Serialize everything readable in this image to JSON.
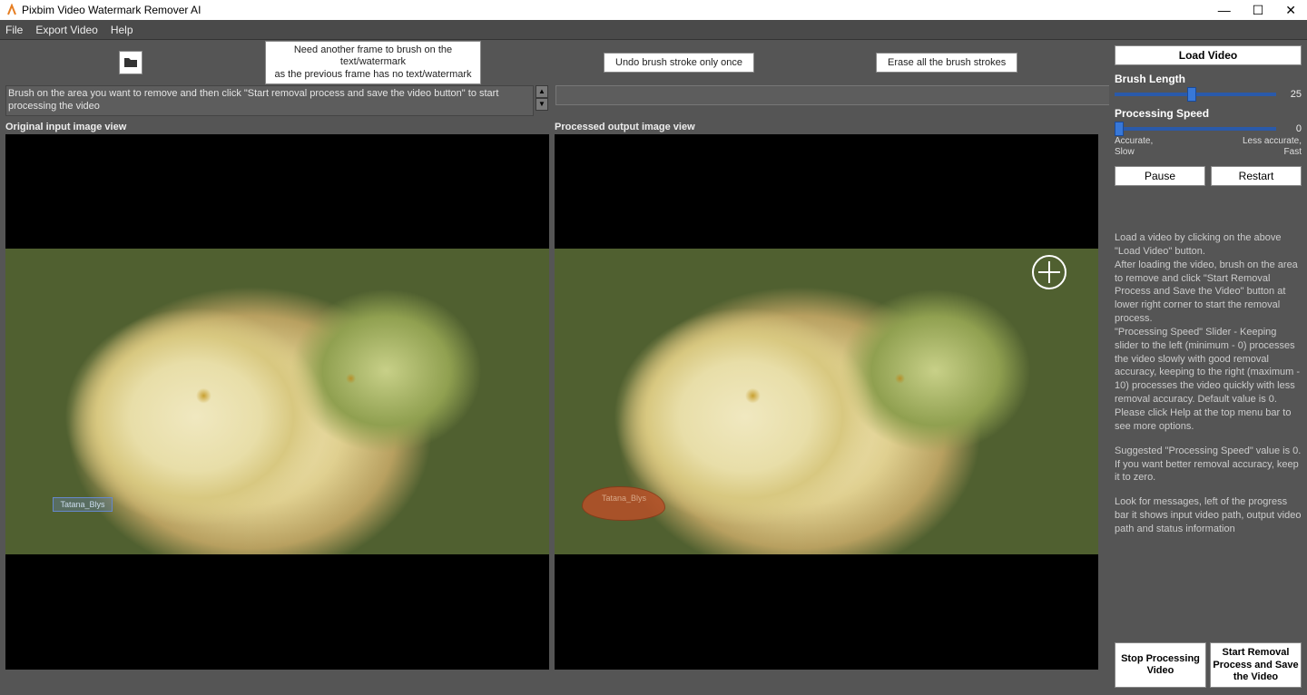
{
  "title_bar": {
    "app_title": "Pixbim Video Watermark Remover AI"
  },
  "menu": {
    "file": "File",
    "export": "Export Video",
    "help": "Help"
  },
  "toolbar": {
    "hint_line1": "Need another frame to brush on the text/watermark",
    "hint_line2": "as the previous frame has no text/watermark",
    "undo": "Undo brush stroke only once",
    "erase": "Erase all the brush strokes"
  },
  "status_text": "Brush on the area you want to remove and then click \"Start removal process and save the video button\" to start processing the video",
  "view_labels": {
    "left": "Original input image view",
    "right": "Processed output image view"
  },
  "watermark_text": "Tatana_Blys",
  "right_panel": {
    "load_video": "Load Video",
    "brush_length_label": "Brush Length",
    "brush_length_value": "25",
    "processing_speed_label": "Processing Speed",
    "processing_speed_value": "0",
    "speed_left_1": "Accurate,",
    "speed_left_2": "Slow",
    "speed_right_1": "Less accurate,",
    "speed_right_2": "Fast",
    "pause": "Pause",
    "restart": "Restart",
    "help_p1": "Load a video by clicking on the above \"Load Video\" button.",
    "help_p2": "After loading the video, brush on the area to remove and click \"Start Removal Process and Save the Video\" button at lower right corner to start the removal process.",
    "help_p3": "\"Processing Speed\" Slider - Keeping slider to the left (minimum - 0) processes the video slowly with good removal accuracy, keeping to the right (maximum - 10) processes the video quickly with less removal accuracy. Default value is 0.",
    "help_p4": "Please click Help at the top menu bar to see more options.",
    "help_p5": "Suggested \"Processing Speed\" value is 0. If you want better removal accuracy, keep it to zero.",
    "help_p6": "Look for messages, left of the progress bar it shows input video path, output video path and status information",
    "stop_processing": "Stop Processing Video",
    "start_removal": "Start Removal Process and Save the Video"
  }
}
